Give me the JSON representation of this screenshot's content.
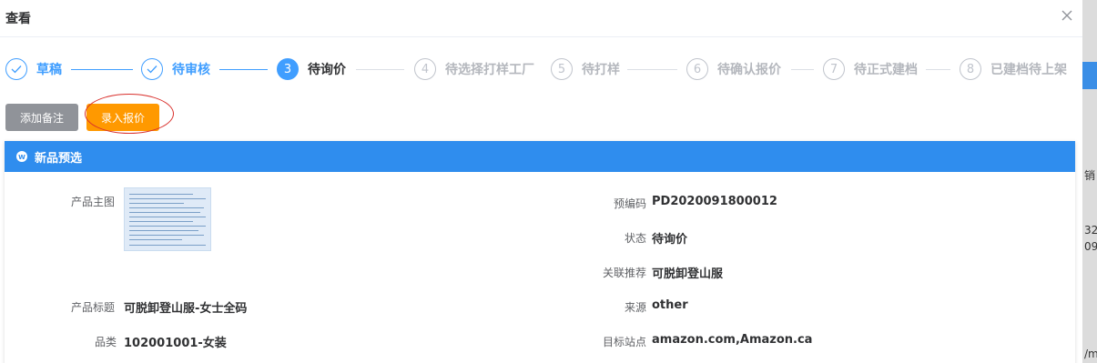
{
  "dialog": {
    "title": "查看"
  },
  "steps": [
    {
      "number": "1",
      "label": "草稿",
      "state": "done"
    },
    {
      "number": "2",
      "label": "待审核",
      "state": "done"
    },
    {
      "number": "3",
      "label": "待询价",
      "state": "active"
    },
    {
      "number": "4",
      "label": "待选择打样工厂",
      "state": "todo"
    },
    {
      "number": "5",
      "label": "待打样",
      "state": "todo"
    },
    {
      "number": "6",
      "label": "待确认报价",
      "state": "todo"
    },
    {
      "number": "7",
      "label": "待正式建档",
      "state": "todo"
    },
    {
      "number": "8",
      "label": "已建档待上架",
      "state": "todo"
    }
  ],
  "actions": {
    "add_remark": "添加备注",
    "enter_quote": "录入报价"
  },
  "panel": {
    "title": "新品预选",
    "fields": {
      "main_image_label": "产品主图",
      "title_label": "产品标题",
      "title_value": "可脱卸登山服-女士全码",
      "category_label": "品类",
      "category_value": "102001001-女装",
      "precode_label": "预编码",
      "precode_value": "PD2020091800012",
      "status_label": "状态",
      "status_value": "待询价",
      "related_label": "关联推荐",
      "related_value": "可脱卸登山服",
      "source_label": "来源",
      "source_value": "other",
      "site_label": "目标站点",
      "site_value": "amazon.com,Amazon.ca"
    }
  },
  "backdrop": {
    "fragments": [
      "销日",
      "32",
      "09",
      "/m/看"
    ]
  },
  "colors": {
    "primary": "#409eff",
    "panel_header": "#2f8dee",
    "warning": "#ff9900",
    "info": "#909399",
    "annotation": "#d9302c"
  }
}
